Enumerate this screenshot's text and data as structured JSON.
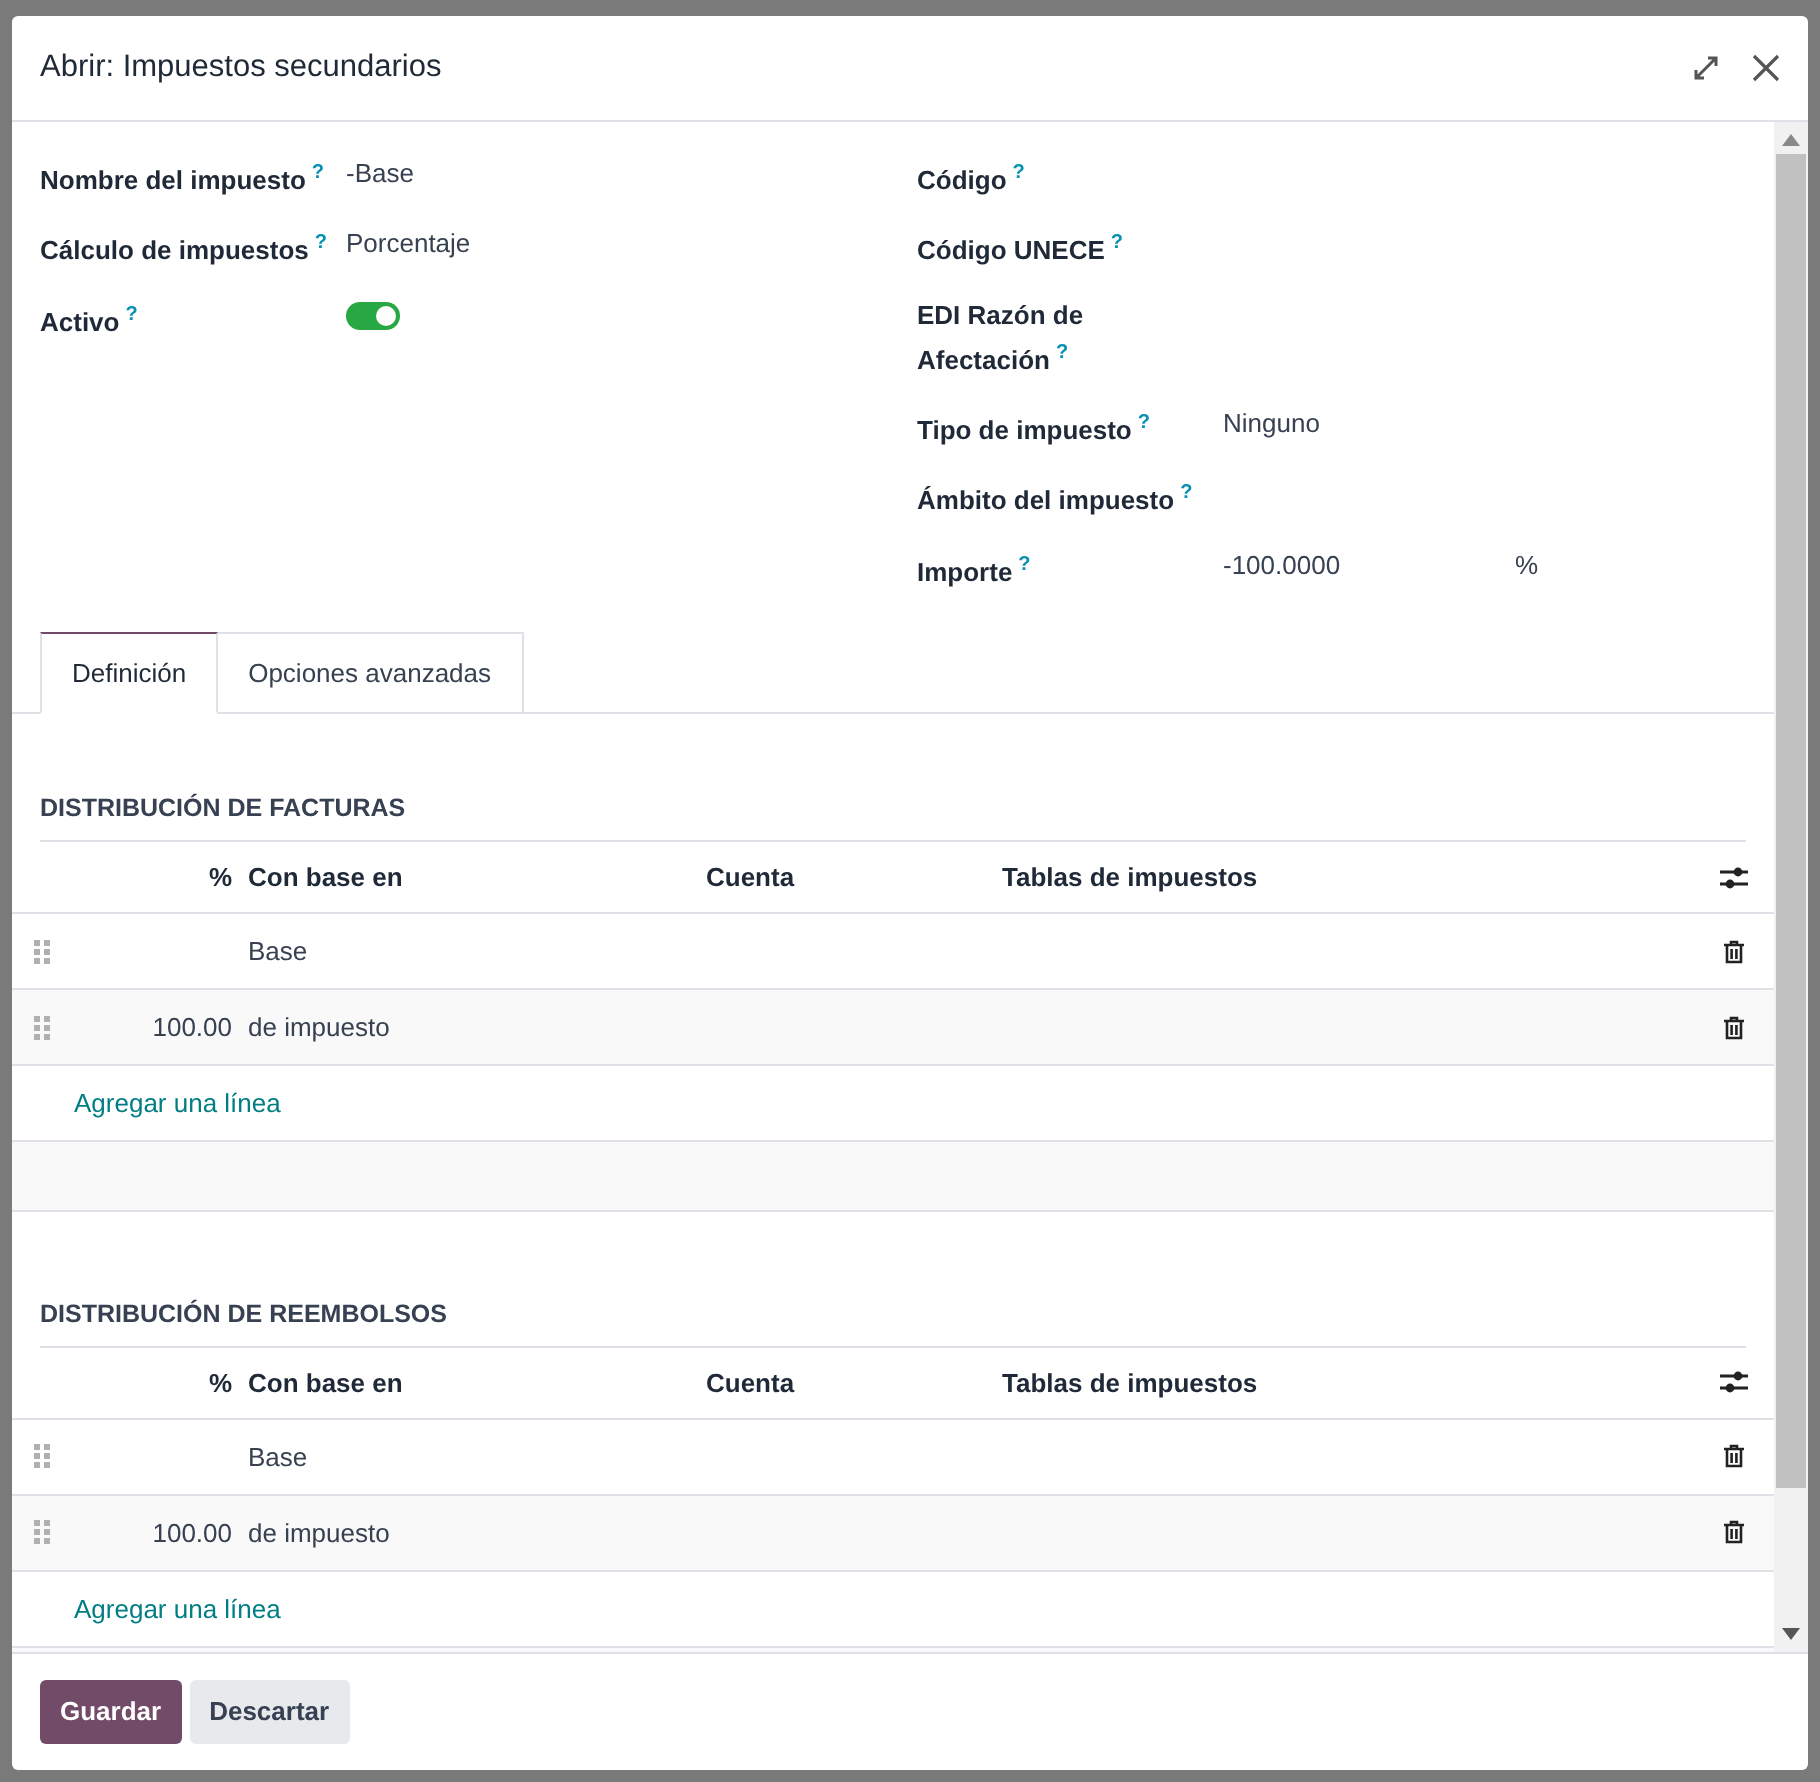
{
  "dialog": {
    "title": "Abrir: Impuestos secundarios"
  },
  "fields_left": [
    {
      "label": "Nombre del impuesto",
      "help": "?",
      "kind": "text",
      "value": "-Base"
    },
    {
      "label": "Cálculo de impuestos",
      "help": "?",
      "kind": "text",
      "value": "Porcentaje"
    },
    {
      "label": "Activo",
      "help": "?",
      "kind": "toggle",
      "on": true
    }
  ],
  "fields_right": [
    {
      "label": "Código",
      "help": "?",
      "kind": "text"
    },
    {
      "label": "Código UNECE",
      "help": "?",
      "kind": "text"
    },
    {
      "label": "EDI Razón de Afectación",
      "help": "?",
      "kind": "text"
    },
    {
      "label": "Tipo de impuesto",
      "help": "?",
      "kind": "text",
      "value": "Ninguno"
    },
    {
      "label": "Ámbito del impuesto",
      "help": "?",
      "kind": "text"
    },
    {
      "label": "Importe",
      "help": "?",
      "kind": "amount",
      "value": "-100.0000",
      "unit": "%"
    }
  ],
  "tabs": [
    {
      "label": "Definición",
      "selected": true
    },
    {
      "label": "Opciones avanzadas",
      "selected": false
    }
  ],
  "sections": [
    {
      "title": "DISTRIBUCIÓN DE FACTURAS",
      "columns": [
        "%",
        "Con base en",
        "Cuenta",
        "Tablas de impuestos"
      ],
      "rows": [
        {
          "percent": "",
          "based_on": "Base"
        },
        {
          "percent": "100.00",
          "based_on": "de impuesto"
        }
      ],
      "add_line": "Agregar una línea"
    },
    {
      "title": "DISTRIBUCIÓN DE REEMBOLSOS",
      "columns": [
        "%",
        "Con base en",
        "Cuenta",
        "Tablas de impuestos"
      ],
      "rows": [
        {
          "percent": "",
          "based_on": "Base"
        },
        {
          "percent": "100.00",
          "based_on": "de impuesto"
        }
      ],
      "add_line": "Agregar una línea"
    }
  ],
  "buttons": [
    {
      "label": "Guardar",
      "kind": "primary"
    },
    {
      "label": "Descartar",
      "kind": "secondary"
    }
  ]
}
